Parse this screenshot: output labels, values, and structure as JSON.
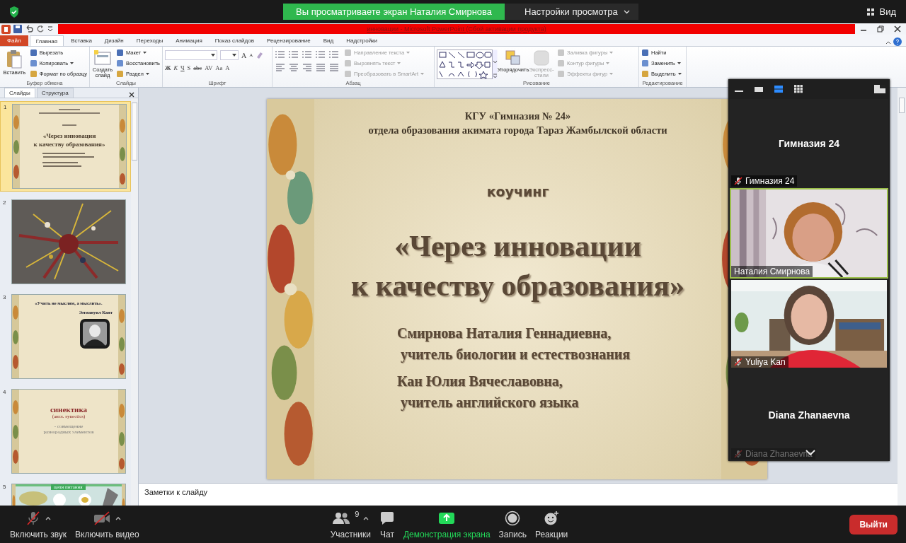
{
  "zoom_top_bar": {
    "sharing_banner": "Вы просматриваете экран Наталия Смирнова",
    "view_options": "Настройки просмотра",
    "view_button": "Вид"
  },
  "powerpoint": {
    "title": "инновации  -  Microsoft PowerPoint (Сбой активации продукта)",
    "ribbon_tabs": [
      {
        "label": "Файл",
        "kind": "file",
        "selected": false
      },
      {
        "label": "Главная",
        "kind": "tab",
        "selected": true
      },
      {
        "label": "Вставка",
        "kind": "tab",
        "selected": false
      },
      {
        "label": "Дизайн",
        "kind": "tab",
        "selected": false
      },
      {
        "label": "Переходы",
        "kind": "tab",
        "selected": false
      },
      {
        "label": "Анимация",
        "kind": "tab",
        "selected": false
      },
      {
        "label": "Показ слайдов",
        "kind": "tab",
        "selected": false
      },
      {
        "label": "Рецензирование",
        "kind": "tab",
        "selected": false
      },
      {
        "label": "Вид",
        "kind": "tab",
        "selected": false
      },
      {
        "label": "Надстройки",
        "kind": "tab",
        "selected": false
      }
    ],
    "ribbon_groups": [
      {
        "kind": "clipboard",
        "name": "Буфер обмена",
        "large": [
          {
            "label": "Вставить",
            "disabled": false
          }
        ],
        "small": [
          {
            "label": "Вырезать",
            "disabled": false,
            "dropdown": false
          },
          {
            "label": "Копировать",
            "disabled": false,
            "dropdown": true
          },
          {
            "label": "Формат по образцу",
            "disabled": false,
            "dropdown": false
          }
        ]
      },
      {
        "kind": "slides",
        "name": "Слайды",
        "large": [
          {
            "label": "Создать слайд",
            "disabled": false
          }
        ],
        "small": [
          {
            "label": "Макет",
            "disabled": false,
            "dropdown": true
          },
          {
            "label": "Восстановить",
            "disabled": false,
            "dropdown": false
          },
          {
            "label": "Раздел",
            "disabled": false,
            "dropdown": true
          }
        ]
      },
      {
        "kind": "font",
        "name": "Шрифт",
        "size_buttons": [
          "A",
          "A"
        ],
        "glyph_buttons": [
          "Ж",
          "К",
          "Ч",
          "S",
          "abc",
          "AV",
          "Aa",
          "A"
        ]
      },
      {
        "kind": "paragraph",
        "name": "Абзац",
        "small": [
          {
            "label": "Направление текста",
            "disabled": true,
            "dropdown": true
          },
          {
            "label": "Выровнять текст",
            "disabled": true,
            "dropdown": true
          },
          {
            "label": "Преобразовать в SmartArt",
            "disabled": true,
            "dropdown": true
          }
        ]
      },
      {
        "kind": "drawing",
        "name": "Рисование",
        "large": [
          {
            "label": "Упорядочить",
            "disabled": false
          },
          {
            "label": "Экспресс-стили",
            "disabled": true
          }
        ],
        "small": [
          {
            "label": "Заливка фигуры",
            "disabled": true,
            "dropdown": true
          },
          {
            "label": "Контур фигуры",
            "disabled": true,
            "dropdown": true
          },
          {
            "label": "Эффекты фигур",
            "disabled": true,
            "dropdown": true
          }
        ]
      },
      {
        "kind": "editing",
        "name": "Редактирование",
        "small": [
          {
            "label": "Найти",
            "disabled": false,
            "dropdown": false
          },
          {
            "label": "Заменить",
            "disabled": false,
            "dropdown": true
          },
          {
            "label": "Выделить",
            "disabled": false,
            "dropdown": true
          }
        ]
      }
    ],
    "pane_tabs": [
      {
        "label": "Слайды",
        "selected": true
      },
      {
        "label": "Структура",
        "selected": false
      }
    ],
    "slides": [
      {
        "number": "1",
        "selected": true,
        "kind": "title",
        "title_lines": [
          "«Через инновации",
          "к качеству образования»"
        ]
      },
      {
        "number": "2",
        "selected": false,
        "kind": "picture"
      },
      {
        "number": "3",
        "selected": false,
        "kind": "quote",
        "quote": "«Учить не мыслям, а мыслить».",
        "author": "Эммануил Кант"
      },
      {
        "number": "4",
        "selected": false,
        "kind": "term",
        "term": "синектика",
        "gloss": "(англ. synectics)",
        "lines": [
          "- совмещение",
          "разнородных  элементов"
        ]
      },
      {
        "number": "5",
        "selected": false,
        "kind": "banner_picture",
        "banner": "цепи питания"
      }
    ],
    "current_slide": {
      "header": [
        "КГУ «Гимназия № 24»",
        "отдела образования акимата города Тараз  Жамбылской области"
      ],
      "subtitle": "коучинг",
      "title_lines": [
        "«Через инновации",
        "к качеству образования»"
      ],
      "authors": [
        {
          "name": "Смирнова Наталия Геннадиевна,",
          "role": "учитель биологии и естествознания"
        },
        {
          "name": "Кан Юлия Вячеславовна,",
          "role": "учитель английского языка"
        }
      ]
    },
    "notes": {
      "placeholder": "Заметки к слайду"
    }
  },
  "zoom_panel": {
    "view_modes": [
      {
        "selected": false
      },
      {
        "selected": false
      },
      {
        "selected": true
      },
      {
        "selected": false
      }
    ],
    "tiles": [
      {
        "kind": "name_only",
        "display_name": "Гимназия 24",
        "label": "Гимназия 24",
        "muted": true,
        "speaking": false
      },
      {
        "kind": "video",
        "label": "Наталия Смирнова",
        "muted": false,
        "speaking": true
      },
      {
        "kind": "video",
        "label": "Yuliya Kan",
        "muted": true,
        "speaking": false
      },
      {
        "kind": "name_only",
        "display_name": "Diana Zhanaevna",
        "label": "Diana Zhanaevna",
        "muted": true,
        "speaking": false
      }
    ]
  },
  "toolbar": {
    "items": [
      {
        "kind": "audio",
        "label": "Включить звук",
        "off": true
      },
      {
        "kind": "video",
        "label": "Включить видео",
        "off": true
      },
      {
        "kind": "participants",
        "label": "Участники",
        "count": "9"
      },
      {
        "kind": "chat",
        "label": "Чат"
      },
      {
        "kind": "share",
        "label": "Демонстрация экрана",
        "active": true
      },
      {
        "kind": "record",
        "label": "Запись"
      },
      {
        "kind": "reactions",
        "label": "Реакции"
      }
    ],
    "leave": "Выйти"
  }
}
